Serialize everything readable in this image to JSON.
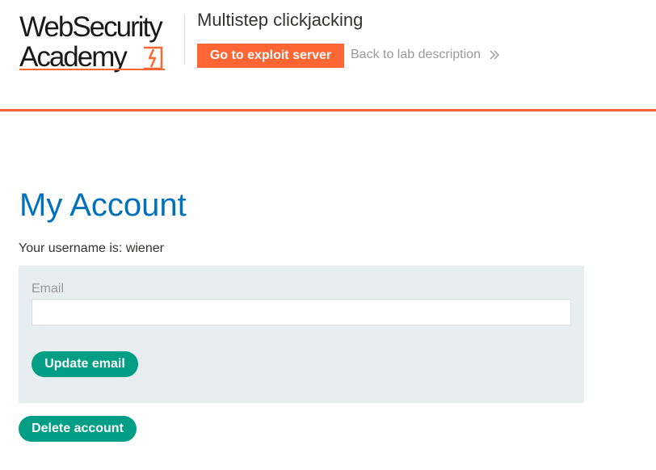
{
  "header": {
    "logo": {
      "line1": "WebSecurity",
      "line2": "Academy"
    },
    "lab_title": "Multistep clickjacking",
    "exploit_button_label": "Go to exploit server",
    "back_link_label": "Back to lab description",
    "accent_color": "#ff6633"
  },
  "main": {
    "title": "My Account",
    "username_text": "Your username is: wiener",
    "email_form": {
      "label": "Email",
      "value": "",
      "placeholder": "",
      "submit_label": "Update email"
    },
    "delete_button_label": "Delete account",
    "title_color": "#0071bc",
    "button_color": "#009e84"
  }
}
